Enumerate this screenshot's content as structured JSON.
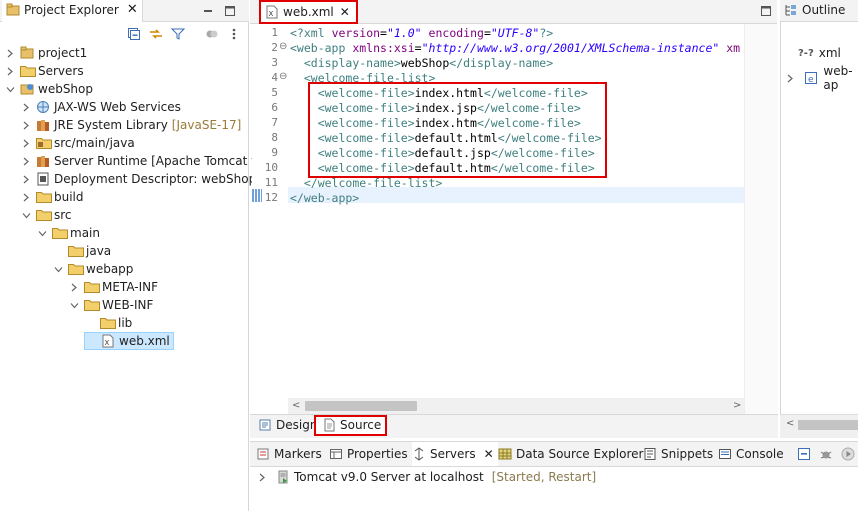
{
  "project_explorer": {
    "tab_title": "Project Explorer",
    "tree": [
      {
        "label": "project1",
        "icon": "project-icon",
        "depth": 0,
        "twisty": "collapsed"
      },
      {
        "label": "Servers",
        "icon": "folder-icon",
        "depth": 0,
        "twisty": "collapsed"
      },
      {
        "label": "webShop",
        "icon": "web-project-icon",
        "depth": 0,
        "twisty": "expanded"
      },
      {
        "label": "JAX-WS Web Services",
        "icon": "webservice-icon",
        "depth": 1,
        "twisty": "collapsed"
      },
      {
        "label": "JRE System Library",
        "decoration": "[JavaSE-17]",
        "icon": "library-icon",
        "depth": 1,
        "twisty": "collapsed"
      },
      {
        "label": "src/main/java",
        "icon": "source-folder-icon",
        "depth": 1,
        "twisty": "collapsed"
      },
      {
        "label": "Server Runtime [Apache Tomcat v9.",
        "icon": "library-icon",
        "depth": 1,
        "twisty": "collapsed"
      },
      {
        "label": "Deployment Descriptor: webShop",
        "icon": "deployment-descriptor-icon",
        "depth": 1,
        "twisty": "collapsed"
      },
      {
        "label": "build",
        "icon": "folder-icon",
        "depth": 1,
        "twisty": "collapsed"
      },
      {
        "label": "src",
        "icon": "folder-icon",
        "depth": 1,
        "twisty": "expanded"
      },
      {
        "label": "main",
        "icon": "folder-icon",
        "depth": 2,
        "twisty": "expanded"
      },
      {
        "label": "java",
        "icon": "folder-icon",
        "depth": 3,
        "twisty": "none"
      },
      {
        "label": "webapp",
        "icon": "folder-icon",
        "depth": 3,
        "twisty": "expanded"
      },
      {
        "label": "META-INF",
        "icon": "folder-icon",
        "depth": 4,
        "twisty": "collapsed"
      },
      {
        "label": "WEB-INF",
        "icon": "folder-icon",
        "depth": 4,
        "twisty": "expanded"
      },
      {
        "label": "lib",
        "icon": "folder-icon",
        "depth": 5,
        "twisty": "none"
      },
      {
        "label": "web.xml",
        "icon": "xml-file-icon",
        "depth": 5,
        "twisty": "none",
        "selected": true
      }
    ]
  },
  "editor": {
    "tab_title": "web.xml",
    "lines": [
      {
        "n": "1",
        "fold": "",
        "segs": [
          [
            "pi",
            "<?"
          ],
          [
            "tg",
            "xml"
          ],
          [
            "tx",
            " "
          ],
          [
            "an",
            "version"
          ],
          [
            "tx",
            "="
          ],
          [
            "av",
            "\"1.0\""
          ],
          [
            "tx",
            " "
          ],
          [
            "an",
            "encoding"
          ],
          [
            "tx",
            "="
          ],
          [
            "av",
            "\"UTF-8\""
          ],
          [
            "pi",
            "?>"
          ]
        ]
      },
      {
        "n": "2",
        "fold": "⊖",
        "segs": [
          [
            "tg",
            "<web-app"
          ],
          [
            "tx",
            " "
          ],
          [
            "an",
            "xmlns:xsi"
          ],
          [
            "tx",
            "="
          ],
          [
            "av",
            "\"http://www.w3.org/2001/XMLSchema-instance\""
          ],
          [
            "tx",
            " "
          ],
          [
            "an",
            "xm"
          ]
        ]
      },
      {
        "n": "3",
        "fold": "",
        "segs": [
          [
            "tx",
            "  "
          ],
          [
            "tg",
            "<display-name>"
          ],
          [
            "tx",
            "webShop"
          ],
          [
            "tg",
            "</display-name>"
          ]
        ]
      },
      {
        "n": "4",
        "fold": "⊖",
        "segs": [
          [
            "tx",
            "  "
          ],
          [
            "tg",
            "<welcome-file-list>"
          ]
        ]
      },
      {
        "n": "5",
        "fold": "",
        "segs": [
          [
            "tx",
            "    "
          ],
          [
            "tg",
            "<welcome-file>"
          ],
          [
            "tx",
            "index.html"
          ],
          [
            "tg",
            "</welcome-file>"
          ]
        ]
      },
      {
        "n": "6",
        "fold": "",
        "segs": [
          [
            "tx",
            "    "
          ],
          [
            "tg",
            "<welcome-file>"
          ],
          [
            "tx",
            "index.jsp"
          ],
          [
            "tg",
            "</welcome-file>"
          ]
        ]
      },
      {
        "n": "7",
        "fold": "",
        "segs": [
          [
            "tx",
            "    "
          ],
          [
            "tg",
            "<welcome-file>"
          ],
          [
            "tx",
            "index.htm"
          ],
          [
            "tg",
            "</welcome-file>"
          ]
        ]
      },
      {
        "n": "8",
        "fold": "",
        "segs": [
          [
            "tx",
            "    "
          ],
          [
            "tg",
            "<welcome-file>"
          ],
          [
            "tx",
            "default.html"
          ],
          [
            "tg",
            "</welcome-file>"
          ]
        ]
      },
      {
        "n": "9",
        "fold": "",
        "segs": [
          [
            "tx",
            "    "
          ],
          [
            "tg",
            "<welcome-file>"
          ],
          [
            "tx",
            "default.jsp"
          ],
          [
            "tg",
            "</welcome-file>"
          ]
        ]
      },
      {
        "n": "10",
        "fold": "",
        "segs": [
          [
            "tx",
            "    "
          ],
          [
            "tg",
            "<welcome-file>"
          ],
          [
            "tx",
            "default.htm"
          ],
          [
            "tg",
            "</welcome-file>"
          ]
        ]
      },
      {
        "n": "11",
        "fold": "",
        "segs": [
          [
            "tx",
            "  "
          ],
          [
            "tg",
            "</welcome-file-list>"
          ]
        ]
      },
      {
        "n": "12",
        "fold": "",
        "segs": [
          [
            "tg",
            "</web-app>"
          ]
        ]
      }
    ],
    "bottom_tabs": {
      "design": "Design",
      "source": "Source"
    }
  },
  "outline": {
    "tab_title": "Outline",
    "items": [
      {
        "label": "xml",
        "icon": "processing-instruction-icon"
      },
      {
        "label": "web-ap",
        "icon": "element-icon"
      }
    ]
  },
  "bottom_panel": {
    "tabs": [
      {
        "label": "Markers",
        "icon": "markers-icon"
      },
      {
        "label": "Properties",
        "icon": "properties-icon"
      },
      {
        "label": "Servers",
        "icon": "servers-icon",
        "active": true
      },
      {
        "label": "Data Source Explorer",
        "icon": "data-source-icon"
      },
      {
        "label": "Snippets",
        "icon": "snippets-icon"
      },
      {
        "label": "Console",
        "icon": "console-icon"
      }
    ],
    "server": {
      "name": "Tomcat v9.0 Server at localhost",
      "state": "[Started, Restart]"
    }
  },
  "colors": {
    "highlight_red": "#e00000",
    "tag": "#3f7f7f",
    "attr_name": "#7f007f",
    "attr_value": "#2a00ff",
    "selection": "#cce8ff"
  }
}
